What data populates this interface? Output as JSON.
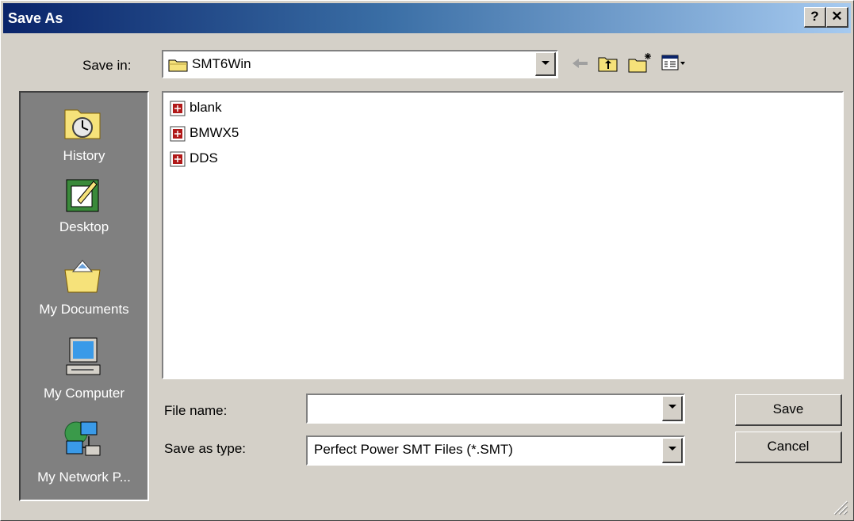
{
  "window": {
    "title": "Save As",
    "help_button": "?",
    "close_button": "✕"
  },
  "save_in": {
    "label": "Save in:",
    "value": "SMT6Win",
    "icon": "folder-icon"
  },
  "toolbar": {
    "icons": [
      "back-icon",
      "up-folder-icon",
      "new-folder-icon",
      "view-menu-icon"
    ]
  },
  "places": [
    {
      "label": "History",
      "icon": "history-icon"
    },
    {
      "label": "Desktop",
      "icon": "desktop-icon"
    },
    {
      "label": "My Documents",
      "icon": "my-documents-icon"
    },
    {
      "label": "My Computer",
      "icon": "my-computer-icon"
    },
    {
      "label": "My Network P...",
      "icon": "network-places-icon"
    }
  ],
  "files": [
    {
      "name": "blank",
      "icon": "smt-file-icon"
    },
    {
      "name": "BMWX5",
      "icon": "smt-file-icon"
    },
    {
      "name": "DDS",
      "icon": "smt-file-icon"
    }
  ],
  "file_name": {
    "label": "File name:",
    "value": ""
  },
  "save_as_type": {
    "label": "Save as type:",
    "value": "Perfect Power SMT Files (*.SMT)"
  },
  "buttons": {
    "save": "Save",
    "cancel": "Cancel"
  },
  "colors": {
    "title_start": "#0a246a",
    "title_end": "#a6caf0",
    "face": "#d4d0c8",
    "places_bg": "#808080"
  }
}
